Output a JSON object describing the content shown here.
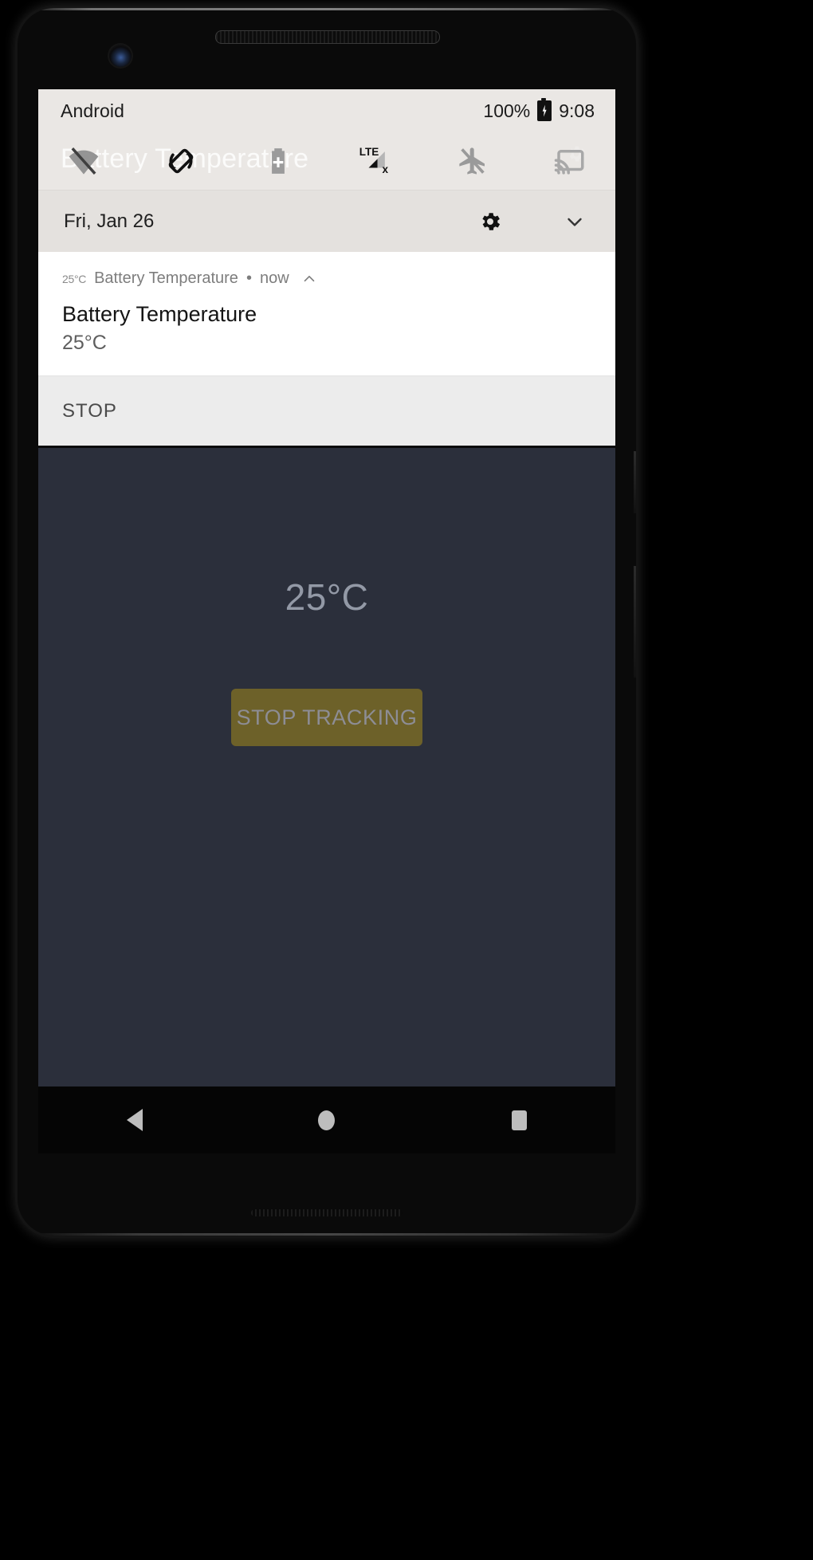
{
  "device": {
    "hardware": {
      "front_camera": "front-camera",
      "earpiece": "earpiece-speaker",
      "power_button": "power-button",
      "volume_button": "volume-button",
      "bottom_mic": "bottom-mic-slot"
    }
  },
  "status_bar": {
    "left_label": "Android",
    "battery_percent": "100%",
    "battery_icon": "battery-charging-icon",
    "clock": "9:08"
  },
  "quick_settings": {
    "ghost_title": "Battery Temperature",
    "icons": [
      {
        "name": "wifi-off-icon",
        "label": "Wi-Fi off"
      },
      {
        "name": "auto-rotate-icon",
        "label": "Auto-rotate"
      },
      {
        "name": "battery-saver-icon",
        "label": "Battery Saver"
      },
      {
        "name": "lte-signal-off-icon",
        "label": "LTE"
      },
      {
        "name": "airplane-mode-off-icon",
        "label": "Airplane mode"
      },
      {
        "name": "cast-icon",
        "label": "Cast"
      }
    ],
    "ghost_gear_icon": "gear-icon"
  },
  "shade_date_row": {
    "date": "Fri, Jan 26",
    "settings_icon": "gear-icon",
    "expand_icon": "chevron-down-icon"
  },
  "notification": {
    "small_icon_text": "25°C",
    "app_name": "Battery Temperature",
    "separator": "•",
    "time": "now",
    "collapse_icon": "chevron-up-icon",
    "title": "Battery Temperature",
    "body": "25°C",
    "action_label": "STOP"
  },
  "app": {
    "temperature": "25°C",
    "button_label": "STOP TRACKING"
  },
  "nav_bar": {
    "back": "back-icon",
    "home": "home-icon",
    "recents": "recents-icon"
  },
  "colors": {
    "shade_background": "#eae7e4",
    "shade_date_background": "#e4e1de",
    "notification_card": "#ffffff",
    "notification_actions": "#ececec",
    "app_background": "#2b2f3b",
    "app_accent_button": "#6d6129",
    "app_text": "#9399a6",
    "nav_bar": "#050505"
  }
}
